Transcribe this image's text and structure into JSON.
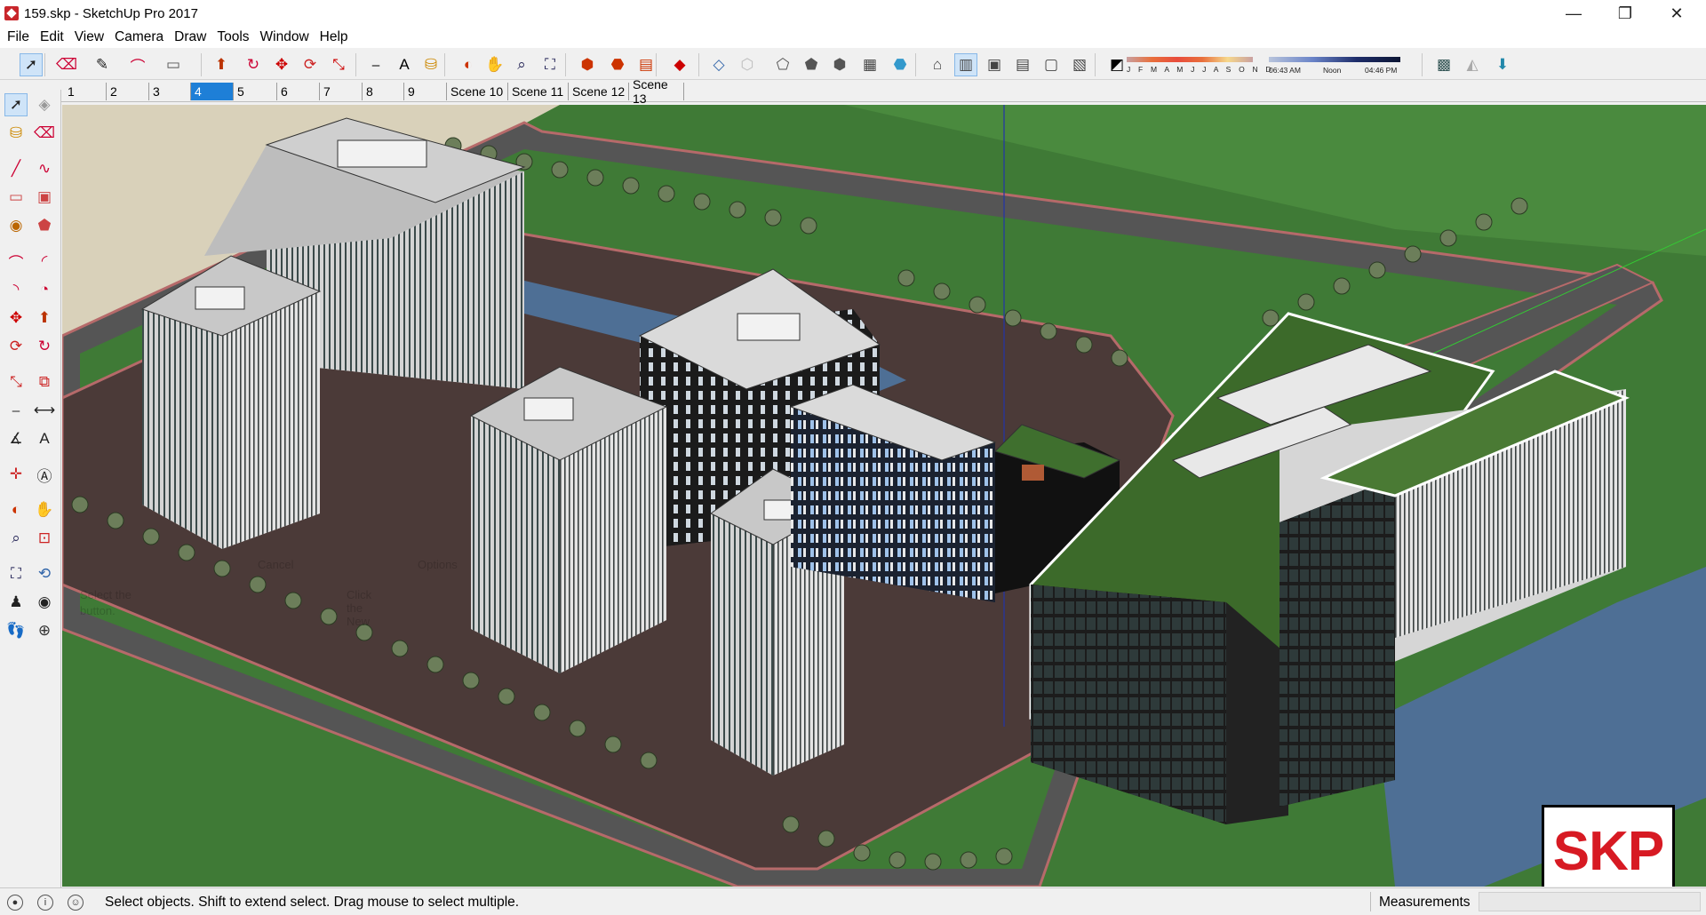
{
  "window": {
    "title": "159.skp - SketchUp Pro 2017",
    "minimize_glyph": "—",
    "restore_glyph": "❐",
    "close_glyph": "✕"
  },
  "menu": [
    "File",
    "Edit",
    "View",
    "Camera",
    "Draw",
    "Tools",
    "Window",
    "Help"
  ],
  "toolbar": {
    "icons": [
      "select-icon",
      "eraser-icon",
      "pencil-line-icon",
      "arc-icon",
      "rectangle-icon",
      "push-pull-icon",
      "follow-me-icon",
      "move-icon",
      "rotate-icon",
      "scale-icon",
      "tape-measure-icon",
      "text-icon",
      "paint-bucket-icon",
      "orbit-icon",
      "pan-icon",
      "zoom-icon",
      "zoom-extents-icon",
      "3d-warehouse-icon",
      "extension-warehouse-icon",
      "layout-icon",
      "ruby-icon",
      "xray-icon",
      "back-edges-icon",
      "wireframe-icon",
      "hidden-line-icon",
      "shaded-icon",
      "shaded-textures-icon",
      "monochrome-icon",
      "iso-view-icon",
      "front-view-icon",
      "right-view-icon",
      "back-view-icon",
      "left-view-icon",
      "top-view-icon",
      "shadows-toggle-icon",
      "add-location-icon",
      "toggle-terrain-icon",
      "photo-textures-icon"
    ],
    "shadow_months": "J F M A M J J A S O N D",
    "shadow_time_start": "06:43 AM",
    "shadow_time_noon": "Noon",
    "shadow_time_end": "04:46 PM"
  },
  "scenes": {
    "tabs": [
      "1",
      "2",
      "3",
      "4",
      "5",
      "6",
      "7",
      "8",
      "9",
      "Scene 10",
      "Scene 11",
      "Scene 12",
      "Scene 13"
    ],
    "active_index": 3
  },
  "left_tools": [
    "select-tool-icon",
    "make-component-icon",
    "paint-bucket-tool-icon",
    "eraser-tool-icon",
    "line-tool-icon",
    "freehand-tool-icon",
    "rectangle-tool-icon",
    "rotated-rectangle-icon",
    "circle-tool-icon",
    "polygon-tool-icon",
    "arc-tool-icon",
    "2point-arc-icon",
    "3point-arc-icon",
    "pie-tool-icon",
    "move-tool-icon",
    "push-pull-tool-icon",
    "rotate-tool-icon",
    "follow-me-tool-icon",
    "scale-tool-icon",
    "offset-tool-icon",
    "tape-measure-tool-icon",
    "dimension-tool-icon",
    "protractor-tool-icon",
    "text-tool-icon",
    "axes-tool-icon",
    "3d-text-icon",
    "orbit-tool-icon",
    "pan-tool-icon",
    "zoom-tool-icon",
    "zoom-window-icon",
    "zoom-extents-tool-icon",
    "previous-view-icon",
    "position-camera-icon",
    "look-around-icon",
    "walk-tool-icon",
    "section-plane-icon"
  ],
  "ghost_instructor": {
    "cancel": "Cancel",
    "options": "Options",
    "line1": "Select the",
    "line2": "button.",
    "line3": "Click the New"
  },
  "logo": {
    "text": "SKP",
    "color": "#d71a23"
  },
  "statusbar": {
    "message": "Select objects. Shift to extend select. Drag mouse to select multiple.",
    "measurements_label": "Measurements",
    "measurements_value": ""
  },
  "colors": {
    "grass": "#3f7a36",
    "sky_ground": "#d9d1ba",
    "plaza": "#4b3a38",
    "curb": "#b66a6a",
    "road": "#4e4e4e",
    "water": "#4e6f95",
    "selected_tab": "#1e7fd7"
  }
}
